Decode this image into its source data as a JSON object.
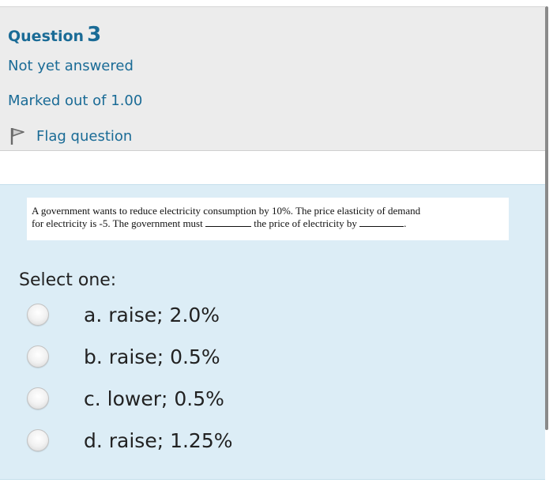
{
  "question": {
    "label": "Question",
    "number": "3",
    "state": "Not yet answered",
    "grade": "Marked out of 1.00",
    "flag_label": "Flag question"
  },
  "prompt": {
    "line1": "A government wants to reduce electricity consumption by 10%. The price elasticity of demand",
    "line2_a": "for electricity is -5. The government must",
    "line2_b": "the price of electricity by",
    "line2_c": "."
  },
  "answer": {
    "select_label": "Select one:",
    "options": [
      {
        "label": "a. raise; 2.0%"
      },
      {
        "label": "b. raise; 0.5%"
      },
      {
        "label": "c. lower; 0.5%"
      },
      {
        "label": "d. raise; 1.25%"
      }
    ]
  },
  "colors": {
    "accent": "#1a6b96",
    "info_bg": "#ececec",
    "formulation_bg": "#dcedf6"
  }
}
